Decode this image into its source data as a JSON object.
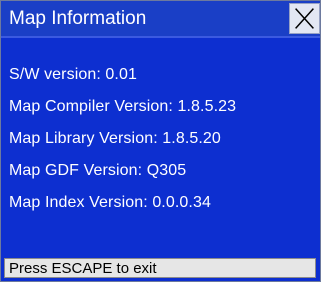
{
  "window": {
    "title": "Map Information",
    "close_icon": "close-x-icon"
  },
  "info": {
    "items": [
      "S/W version: 0.01",
      "Map Compiler Version: 1.8.5.23",
      "Map Library Version: 1.8.5.20",
      "Map GDF Version: Q305",
      "Map Index Version: 0.0.0.34"
    ]
  },
  "status": {
    "text": "Press ESCAPE to exit"
  },
  "colors": {
    "background": "#0d2fd0",
    "title_bar": "#1a3fc6",
    "text": "#ffffff",
    "status_bar": "#e6e6e6"
  }
}
